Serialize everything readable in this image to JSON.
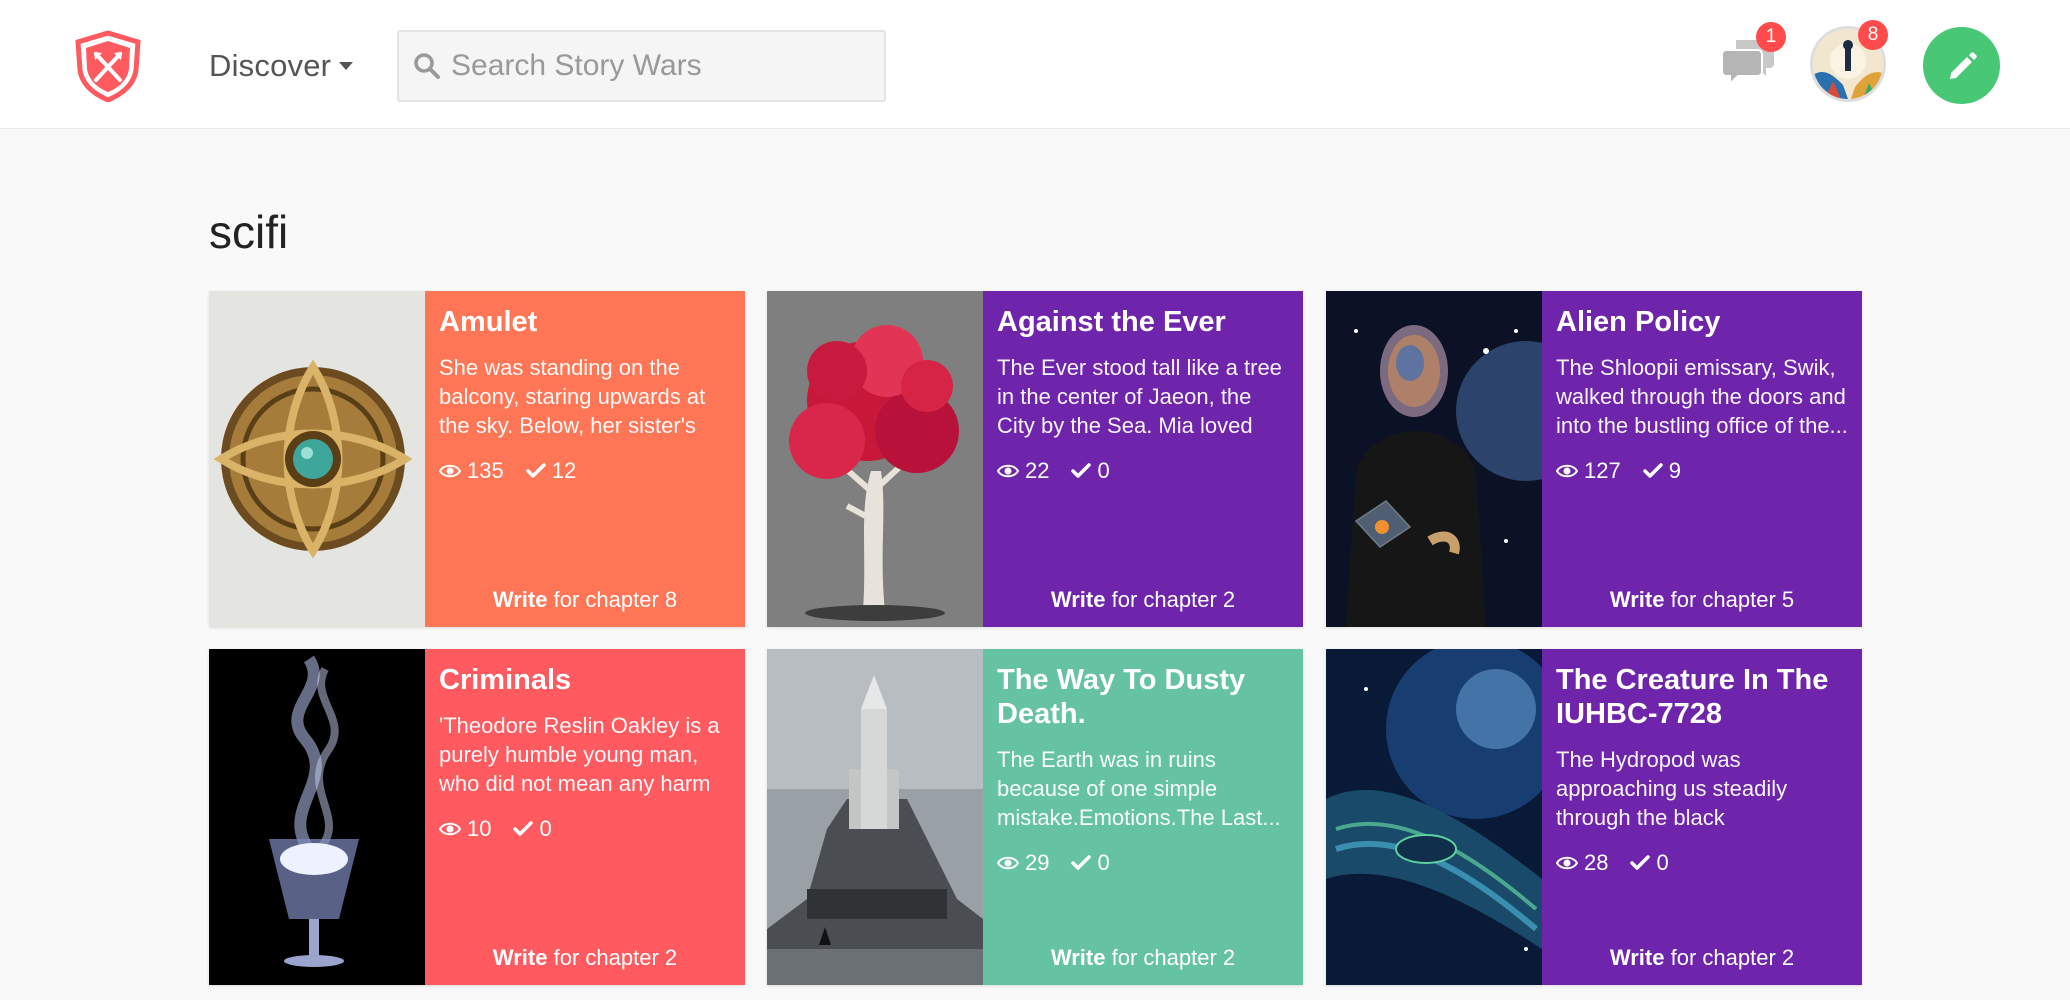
{
  "header": {
    "discover_label": "Discover",
    "search_placeholder": "Search Story Wars",
    "messages_badge": "1",
    "notifications_badge": "8"
  },
  "colors": {
    "orange": "#ff7657",
    "purple": "#6e24ab",
    "red": "#ff5a5f",
    "teal": "#65c3a4",
    "green": "#48c774",
    "badge_red": "#ff4b4b"
  },
  "section_title": "scifi",
  "cards": [
    {
      "title": "Amulet",
      "excerpt": "She was standing on the balcony, staring upwards at the sky. Below, her sister's party...",
      "views": "135",
      "votes": "12",
      "write": "Write",
      "chapter": "for chapter 8",
      "color": "orange",
      "image": "amulet"
    },
    {
      "title": "Against the Ever",
      "excerpt": "The Ever stood tall like a tree in the center of Jaeon, the City by the Sea. Mia loved gazing...",
      "views": "22",
      "votes": "0",
      "write": "Write",
      "chapter": "for chapter 2",
      "color": "purple",
      "image": "red-tree"
    },
    {
      "title": "Alien Policy",
      "excerpt": "The Shloopii emissary, Swik, walked through the doors and into the bustling office of the...",
      "views": "127",
      "votes": "9",
      "write": "Write",
      "chapter": "for chapter 5",
      "color": "purple",
      "image": "alien-figure"
    },
    {
      "title": "Criminals",
      "excerpt": "'Theodore Reslin Oakley is a purely humble young man, who did not mean any harm or...",
      "views": "10",
      "votes": "0",
      "write": "Write",
      "chapter": "for chapter 2",
      "color": "red",
      "image": "smoking-glass"
    },
    {
      "title": "The Way To Dusty Death.",
      "excerpt": "The Earth was in ruins because of one simple mistake.Emotions.The Last...",
      "views": "29",
      "votes": "0",
      "write": "Write",
      "chapter": "for chapter 2",
      "color": "teal",
      "image": "rocket-mountain"
    },
    {
      "title": "The Creature In The IUHBC-7728",
      "excerpt": "The Hydropod was approaching us steadily through the black space.\"ETA...",
      "views": "28",
      "votes": "0",
      "write": "Write",
      "chapter": "for chapter 2",
      "color": "purple",
      "image": "spaceship"
    }
  ]
}
